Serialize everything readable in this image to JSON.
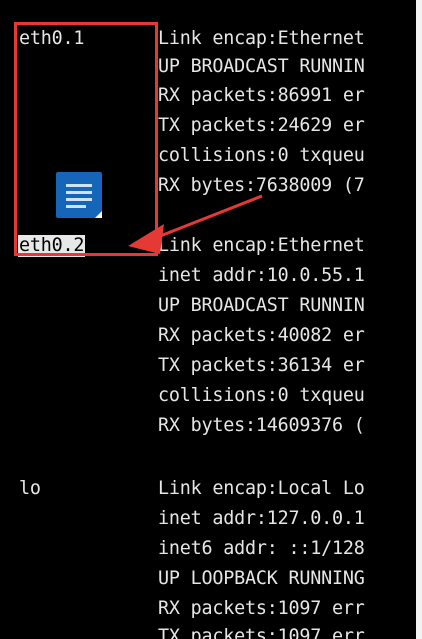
{
  "interfaces": [
    {
      "name": "eth0.1",
      "lines": [
        "Link encap:Ethernet",
        "UP BROADCAST RUNNIN",
        "RX packets:86991 er",
        "TX packets:24629 er",
        "collisions:0 txqueu",
        "RX bytes:7638009 (7"
      ]
    },
    {
      "name": "eth0.2",
      "selected": true,
      "lines": [
        "Link encap:Ethernet",
        "inet addr:10.0.55.1",
        "UP BROADCAST RUNNIN",
        "RX packets:40082 er",
        "TX packets:36134 er",
        "collisions:0 txqueu",
        "RX bytes:14609376 ("
      ]
    },
    {
      "name": "lo",
      "lines": [
        "Link encap:Local Lo",
        "inet addr:127.0.0.1",
        "inet6 addr: ::1/128",
        "UP LOOPBACK RUNNING",
        "RX packets:1097 err",
        "TX packets:1097 err"
      ]
    }
  ],
  "annotation": {
    "color": "#e53935",
    "icon": "document-icon"
  }
}
